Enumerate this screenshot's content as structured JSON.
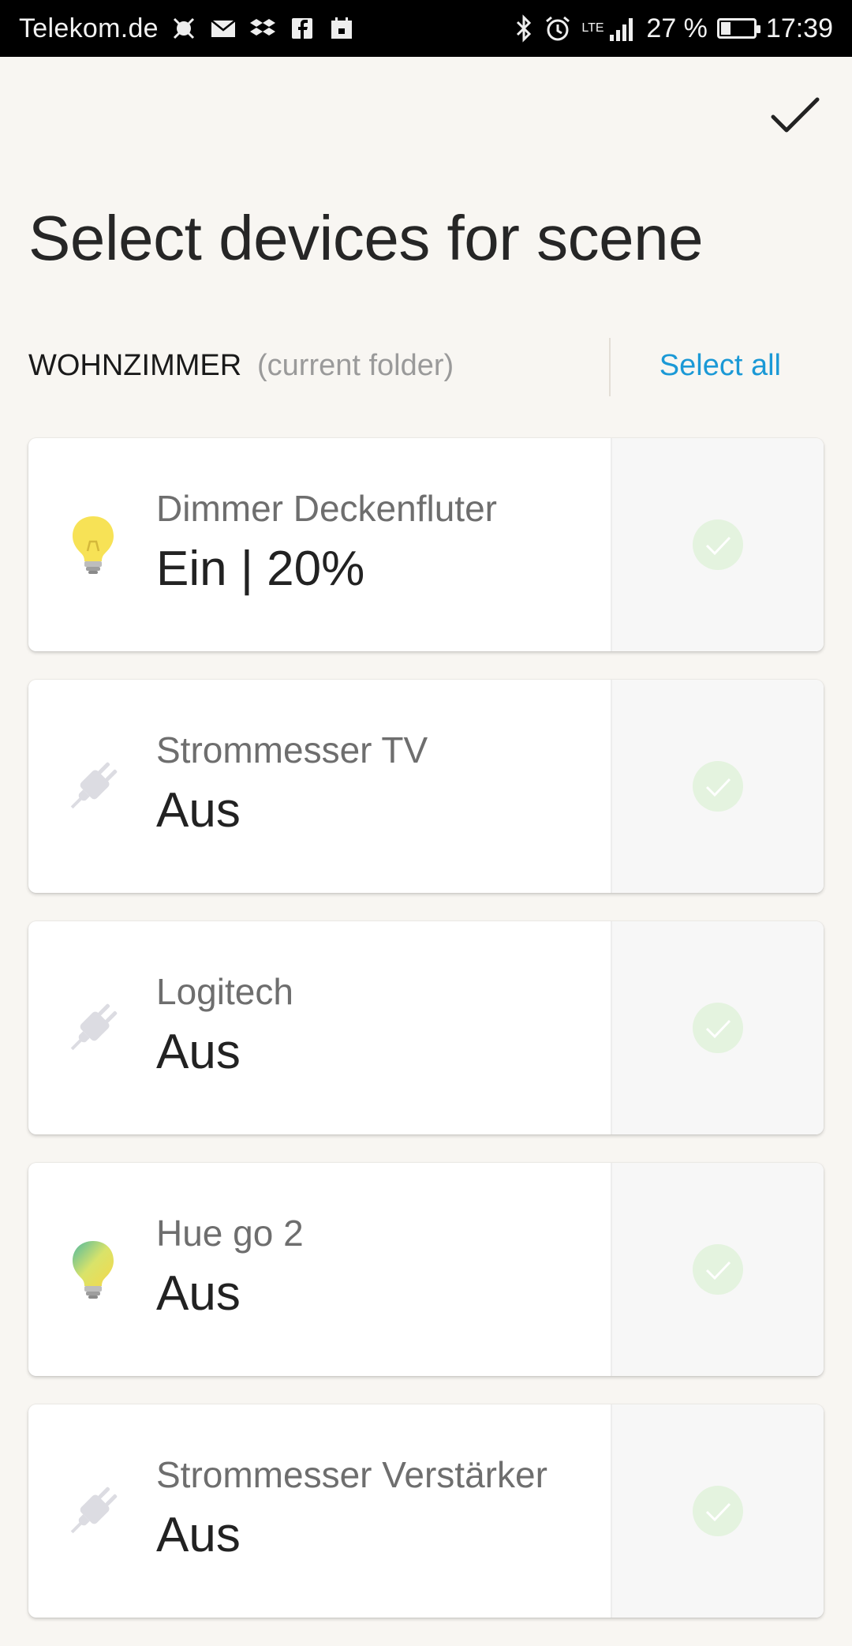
{
  "statusbar": {
    "carrier": "Telekom.de",
    "network": "LTE",
    "battery": "27 %",
    "time": "17:39"
  },
  "header": {
    "title": "Select devices for scene",
    "confirm_icon": "checkmark-icon"
  },
  "folder": {
    "name": "WOHNZIMMER",
    "hint": "(current folder)",
    "select_all": "Select all"
  },
  "colors": {
    "accent": "#1b99d6",
    "background": "#f8f6f2",
    "check": "#e4f3df"
  },
  "devices": [
    {
      "name": "Dimmer Deckenfluter",
      "state": "Ein | 20%",
      "icon": "bulb-yellow-icon"
    },
    {
      "name": "Strommesser TV",
      "state": "Aus",
      "icon": "plug-icon"
    },
    {
      "name": "Logitech",
      "state": "Aus",
      "icon": "plug-icon"
    },
    {
      "name": "Hue go 2",
      "state": "Aus",
      "icon": "bulb-color-icon"
    },
    {
      "name": "Strommesser Verstärker",
      "state": "Aus",
      "icon": "plug-icon"
    }
  ]
}
